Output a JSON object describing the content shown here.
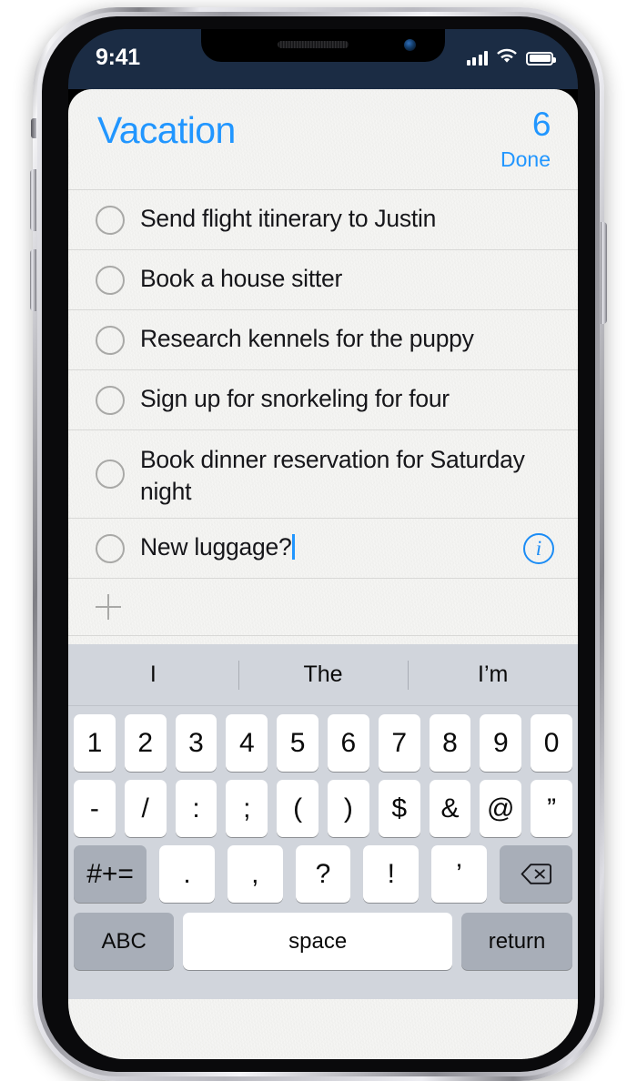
{
  "status_bar": {
    "time": "9:41",
    "signal_icon": "cellular-signal-icon",
    "wifi_icon": "wifi-icon",
    "battery_icon": "battery-full-icon"
  },
  "app": {
    "name": "Reminders",
    "accent_color": "#2196ff",
    "paper_background": "#f2f2f0"
  },
  "header": {
    "title": "Vacation",
    "count": "6",
    "done_label": "Done"
  },
  "reminders": [
    {
      "text": "Send flight itinerary to Justin",
      "completed": false,
      "has_info": false,
      "editing": false
    },
    {
      "text": "Book a house sitter",
      "completed": false,
      "has_info": false,
      "editing": false
    },
    {
      "text": "Research kennels for the puppy",
      "completed": false,
      "has_info": false,
      "editing": false
    },
    {
      "text": "Sign up for snorkeling for four",
      "completed": false,
      "has_info": false,
      "editing": false
    },
    {
      "text": "Book dinner reservation for Saturday\nnight",
      "completed": false,
      "has_info": false,
      "editing": false
    },
    {
      "text": "New luggage?",
      "completed": false,
      "has_info": true,
      "editing": true
    }
  ],
  "add_row": {
    "icon": "plus-icon",
    "label": ""
  },
  "keyboard": {
    "layout": "numeric-symbols",
    "predictions": [
      "I",
      "The",
      "I’m"
    ],
    "row_numbers": [
      "1",
      "2",
      "3",
      "4",
      "5",
      "6",
      "7",
      "8",
      "9",
      "0"
    ],
    "row_symbols": [
      "-",
      "/",
      ":",
      ";",
      "(",
      ")",
      "$",
      "&",
      "@",
      "”"
    ],
    "row_symbols2": {
      "shift_label": "#+=",
      "keys": [
        ".",
        ",",
        "?",
        "!",
        "’"
      ],
      "delete_icon": "delete-backward-icon"
    },
    "row_bottom": {
      "abc_label": "ABC",
      "space_label": "space",
      "return_label": "return"
    }
  }
}
